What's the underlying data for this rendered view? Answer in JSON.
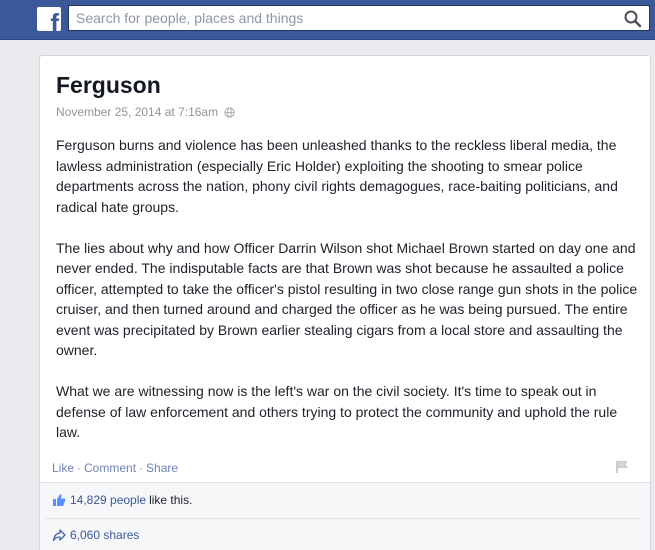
{
  "header": {
    "logo_letter": "f",
    "search_placeholder": "Search for people, places and things",
    "icons": {
      "logo": "facebook-logo",
      "search": "magnifier-icon"
    }
  },
  "post": {
    "title": "Ferguson",
    "date": "November 25, 2014 at 7:16am",
    "paragraphs": [
      "Ferguson burns and violence has been unleashed thanks to the reckless liberal media, the lawless administration (especially Eric Holder) exploiting the shooting to smear police departments across the nation, phony civil rights demagogues, race-baiting politicians, and radical hate groups.",
      "The lies about why and how Officer Darrin Wilson shot Michael Brown started on day one and never ended.  The indisputable facts are that Brown was shot because he assaulted a police officer, attempted to take the officer's pistol resulting in two close range gun shots in the police cruiser, and then turned around and charged the officer as he was being pursued. The entire event was precipitated by Brown earlier stealing cigars from a local store and assaulting the owner.",
      "What we are witnessing now is the left's war on the civil society.  It's time to speak out in defense of law enforcement and others trying to protect the community and uphold the rule law."
    ],
    "actions": {
      "like": "Like",
      "comment": "Comment",
      "share": "Share",
      "separator": "·"
    },
    "likes": {
      "count": "14,829 people",
      "suffix": "like this."
    },
    "shares": {
      "count": "6,060 shares"
    }
  },
  "colors": {
    "brand": "#3b5998",
    "link": "#6d84b4",
    "text": "#1d2129",
    "muted": "#90949c"
  }
}
